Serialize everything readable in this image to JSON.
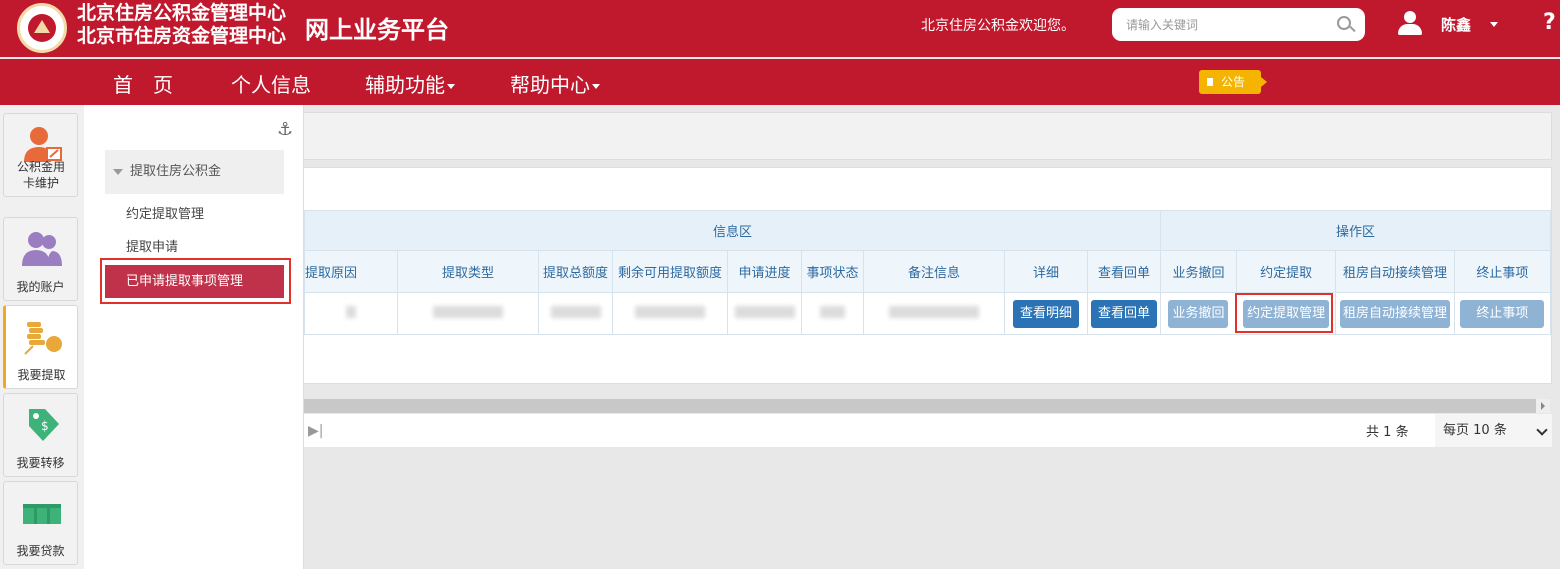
{
  "header": {
    "org_line1": "北京住房公积金管理中心",
    "org_line2": "北京市住房资金管理中心",
    "platform": "网上业务平台",
    "welcome": "北京住房公积金欢迎您。",
    "search_placeholder": "请输入关键词",
    "username": "陈鑫",
    "help": "?"
  },
  "nav": {
    "home": "首　页",
    "personal": "个人信息",
    "aux": "辅助功能",
    "helpcenter": "帮助中心",
    "notice": "公告"
  },
  "leftnav": {
    "items": [
      {
        "label": "公积金用卡维护"
      },
      {
        "label": "我的账户"
      },
      {
        "label": "我要提取"
      },
      {
        "label": "我要转移"
      },
      {
        "label": "我要贷款"
      }
    ]
  },
  "submenu": {
    "group": "提取住房公积金",
    "items": [
      "约定提取管理",
      "提取申请",
      "已申请提取事项管理"
    ]
  },
  "table": {
    "group_info": "信息区",
    "group_ops": "操作区",
    "headers": [
      "提取原因",
      "提取类型",
      "提取总额度",
      "剩余可用提取额度",
      "申请进度",
      "事项状态",
      "备注信息",
      "详细",
      "查看回单",
      "业务撤回",
      "约定提取",
      "租房自动接续管理",
      "终止事项"
    ],
    "buttons": [
      "查看明细",
      "查看回单",
      "业务撤回",
      "约定提取管理",
      "租房自动接续管理",
      "终止事项"
    ]
  },
  "pager": {
    "total_prefix": "共",
    "total_count": "1",
    "total_suffix": "条",
    "per_label": "每页",
    "per_value": "10",
    "per_unit": "条"
  },
  "colors": {
    "brand_red": "#c0192e",
    "button_blue": "#2b73b4",
    "button_light": "#8fb3d5",
    "notice_yellow": "#f5b400"
  }
}
